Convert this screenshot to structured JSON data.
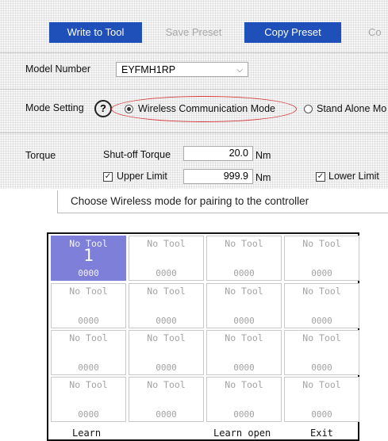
{
  "toolbar": {
    "write_to_tool": "Write to Tool",
    "save_preset": "Save Preset",
    "copy_preset": "Copy Preset",
    "cut_button": "Co"
  },
  "model": {
    "label": "Model Number",
    "value": "EYFMH1RP"
  },
  "mode": {
    "label": "Mode Setting",
    "help": "?",
    "wireless": "Wireless Communication Mode",
    "standalone": "Stand Alone Mo",
    "selected": "wireless"
  },
  "torque": {
    "label": "Torque",
    "shutoff_label": "Shut-off Torque",
    "shutoff_value": "20.0",
    "shutoff_unit": "Nm",
    "upper_label": "Upper Limit",
    "upper_value": "999.9",
    "upper_unit": "Nm",
    "lower_label": "Lower Limit"
  },
  "callout": "Choose Wireless mode for pairing to the controller",
  "display": {
    "cells": [
      {
        "name": "No Tool",
        "number": "1",
        "code": "0000",
        "selected": true
      },
      {
        "name": "No Tool",
        "number": "",
        "code": "0000",
        "selected": false
      },
      {
        "name": "No Tool",
        "number": "",
        "code": "0000",
        "selected": false
      },
      {
        "name": "No Tool",
        "number": "",
        "code": "0000",
        "selected": false
      },
      {
        "name": "No Tool",
        "number": "",
        "code": "0000",
        "selected": false
      },
      {
        "name": "No Tool",
        "number": "",
        "code": "0000",
        "selected": false
      },
      {
        "name": "No Tool",
        "number": "",
        "code": "0000",
        "selected": false
      },
      {
        "name": "No Tool",
        "number": "",
        "code": "0000",
        "selected": false
      },
      {
        "name": "No Tool",
        "number": "",
        "code": "0000",
        "selected": false
      },
      {
        "name": "No Tool",
        "number": "",
        "code": "0000",
        "selected": false
      },
      {
        "name": "No Tool",
        "number": "",
        "code": "0000",
        "selected": false
      },
      {
        "name": "No Tool",
        "number": "",
        "code": "0000",
        "selected": false
      },
      {
        "name": "No Tool",
        "number": "",
        "code": "0000",
        "selected": false
      },
      {
        "name": "No Tool",
        "number": "",
        "code": "0000",
        "selected": false
      },
      {
        "name": "No Tool",
        "number": "",
        "code": "0000",
        "selected": false
      },
      {
        "name": "No Tool",
        "number": "",
        "code": "0000",
        "selected": false
      }
    ],
    "softkeys": {
      "left": "Learn",
      "middle": "Learn open",
      "right": "Exit"
    }
  },
  "colors": {
    "primary_button": "#1f4fb8",
    "selected_cell": "#7e7fd9",
    "highlight_ellipse": "#d43a3a"
  }
}
